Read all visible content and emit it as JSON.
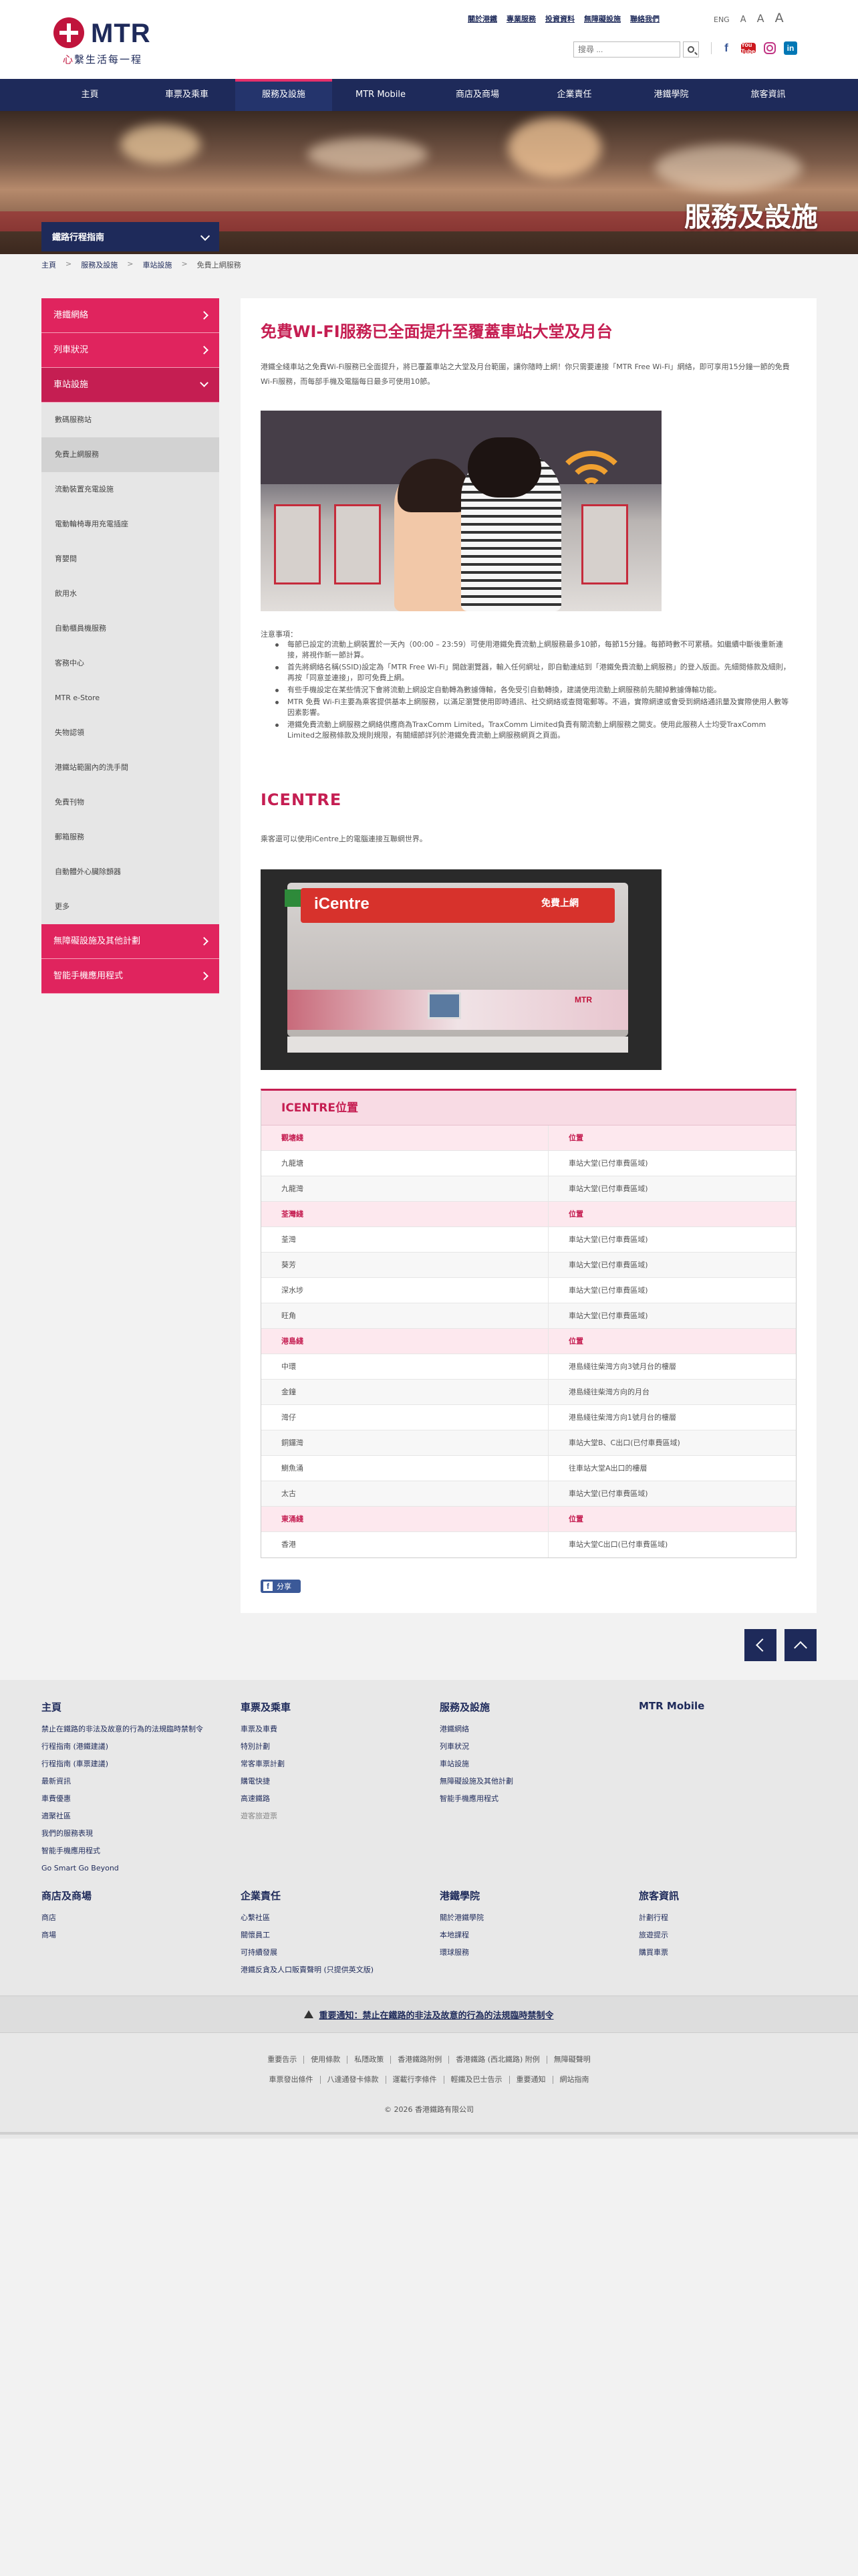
{
  "header": {
    "logo_text": "MTR",
    "slogan_red": "心",
    "slogan_rest": "繫生活每一程",
    "top_links": [
      "關於港鐵",
      "專業服務",
      "投資資料",
      "無障礙設施",
      "聯絡我們"
    ],
    "lang": [
      "ENG",
      "A",
      "A",
      "A"
    ],
    "search_placeholder": "搜尋 ...",
    "social": [
      "f",
      "You Tube",
      "",
      "in"
    ]
  },
  "nav": {
    "items": [
      "主頁",
      "車票及乘車",
      "服務及設施",
      "MTR Mobile",
      "商店及商場",
      "企業責任",
      "港鐵學院",
      "旅客資訊"
    ],
    "active_index": 2
  },
  "banner": {
    "title": "服務及設施",
    "journey_planner": "鐵路行程指南"
  },
  "breadcrumb": [
    "主頁",
    "服務及設施",
    "車站設施",
    "免費上網服務"
  ],
  "sidebar": {
    "main_top": [
      "港鐵網絡",
      "列車狀況"
    ],
    "open_section": "車站設施",
    "sub_items": [
      "數碼服務站",
      "免費上網服務",
      "流動裝置充電設施",
      "電動輪椅專用充電插座",
      "育嬰間",
      "飲用水",
      "自動櫃員機服務",
      "客務中心",
      "MTR e-Store",
      "失物認領",
      "港鐵站範圍內的洗手間",
      "免費刊物",
      "郵箱服務",
      "自動體外心臟除顫器",
      "更多"
    ],
    "active_sub": "免費上網服務",
    "main_bottom": [
      "無障礙設施及其他計劃",
      "智能手機應用程式"
    ]
  },
  "content": {
    "title": "免費WI-FI服務已全面提升至覆蓋車站大堂及月台",
    "intro": "港鐵全綫車站之免費Wi-Fi服務已全面提升，將已覆蓋車站之大堂及月台範圍，讓你隨時上網！你只需要連接「MTR Free Wi-Fi」網絡，即可享用15分鐘一節的免費Wi-Fi服務，而每部手機及電腦每日最多可使用10節。",
    "notes_label": "注意事項：",
    "notes": [
      "每節已設定的流動上網裝置於一天內（00:00 – 23:59）可使用港鐵免費流動上網服務最多10節，每節15分鐘。每節時數不可累積。如繼續中斷後重新連接，將視作新一節計算。",
      "首先將網絡名稱(SSID)設定為「MTR Free Wi-Fi」開啟瀏覽器，輸入任何網址，即自動連結到「港鐵免費流動上網服務」的登入版面。先細閱條款及細則，再按「同意並連接」，即可免費上網。",
      "有些手機設定在某些情況下會將流動上網設定自動轉為數據傳輸，各免受引自動轉換，建議使用流動上網服務前先關掉數據傳輸功能。",
      "MTR 免費 Wi-Fi主要為乘客提供基本上網服務，以滿足瀏覽使用即時通訊、社交網絡或查閱電郵等。不過，實際網速或會受到網絡通訊量及實際使用人數等因素影響。",
      "港鐵免費流動上網服務之網絡供應商為TraxComm Limited。TraxComm Limited負責有關流動上網服務之開支。使用此服務人士均受TraxComm Limited之服務條款及規則規限，有關細節詳列於港鐵免費流動上網服務網頁之頁面。"
    ],
    "icentre_title": "ICENTRE",
    "icentre_desc": "乘客還可以使用iCentre上的電腦連接互聯網世界。",
    "photo2_sign": "iCentre",
    "photo2_sign_cn": "免費上網",
    "photo2_brand": "MTR",
    "location_title": "ICENTRE位置",
    "location_groups": [
      {
        "line": "觀塘綫",
        "header_right": "位置",
        "rows": [
          [
            "九龍塘",
            "車站大堂(已付車費區域)"
          ],
          [
            "九龍灣",
            "車站大堂(已付車費區域)"
          ]
        ]
      },
      {
        "line": "荃灣綫",
        "header_right": "位置",
        "rows": [
          [
            "荃灣",
            "車站大堂(已付車費區域)"
          ],
          [
            "葵芳",
            "車站大堂(已付車費區域)"
          ],
          [
            "深水埗",
            "車站大堂(已付車費區域)"
          ],
          [
            "旺角",
            "車站大堂(已付車費區域)"
          ]
        ]
      },
      {
        "line": "港島綫",
        "header_right": "位置",
        "rows": [
          [
            "中環",
            "港島綫往柴灣方向3號月台的樓層"
          ],
          [
            "金鐘",
            "港島綫往柴灣方向的月台"
          ],
          [
            "灣仔",
            "港島綫往柴灣方向1號月台的樓層"
          ],
          [
            "銅鑼灣",
            "車站大堂B、C出口(已付車費區域)"
          ],
          [
            "鰂魚涌",
            "往車站大堂A出口的樓層"
          ],
          [
            "太古",
            "車站大堂(已付車費區域)"
          ]
        ]
      },
      {
        "line": "東涌綫",
        "header_right": "位置",
        "rows": [
          [
            "香港",
            "車站大堂C出口(已付車費區域)"
          ]
        ]
      }
    ],
    "share_label": "分享"
  },
  "footer": {
    "columns": [
      {
        "title": "主頁",
        "items": [
          "禁止在鐵路的非法及故意的行為的法規臨時禁制令",
          "行程指南 (港鐵建議)",
          "行程指南 (車票建議)",
          "最新資訊",
          "車費優惠",
          "適聚社區",
          "我們的服務表現",
          "智能手機應用程式",
          "Go Smart Go Beyond"
        ]
      },
      {
        "title": "車票及乘車",
        "items": [
          "車票及車費",
          "特別計劃",
          "常客車票計劃",
          "購電快捷",
          "高速鐵路",
          "遊客旅遊票"
        ]
      },
      {
        "title": "服務及設施",
        "items": [
          "港鐵網絡",
          "列車狀況",
          "車站設施",
          "無障礙設施及其他計劃",
          "智能手機應用程式"
        ]
      },
      {
        "title": "MTR Mobile",
        "items": []
      },
      {
        "title": "商店及商場",
        "items": [
          "商店",
          "商場"
        ]
      },
      {
        "title": "企業責任",
        "items": [
          "心繫社區",
          "關懷員工",
          "可持續發展",
          "港鐵反貪及人口販賣聲明 (只提供英文版)"
        ]
      },
      {
        "title": "港鐵學院",
        "items": [
          "關於港鐵學院",
          "本地課程",
          "環球服務"
        ]
      },
      {
        "title": "旅客資訊",
        "items": [
          "計劃行程",
          "旅遊提示",
          "購買車票"
        ]
      }
    ],
    "notice": "重要通知：禁止在鐵路的非法及故意的行為的法規臨時禁制令",
    "links_row1": [
      "重要告示",
      "使用條款",
      "私隱政策",
      "香港鐵路附例",
      "香港鐵路 (西北鐵路) 附例",
      "無障礙聲明"
    ],
    "links_row2": [
      "車票發出條件",
      "八達通發卡條款",
      "運載行李條件",
      "輕鐵及巴士告示",
      "重要通知",
      "網站指南"
    ],
    "copyright": "© 2026 香港鐵路有限公司"
  }
}
